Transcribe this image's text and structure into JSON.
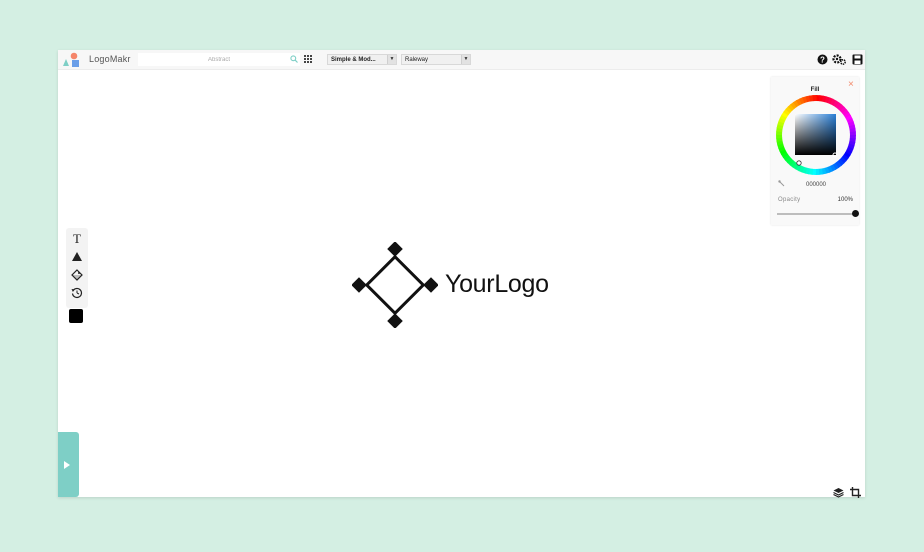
{
  "app": {
    "name": "LogoMakr"
  },
  "toolbar": {
    "search_placeholder": "Abstract",
    "style_select": "Simple & Mod...",
    "font_select": "Raleway"
  },
  "canvas": {
    "logo_text": "YourLogo"
  },
  "fill_panel": {
    "title": "Fill",
    "close_label": "×",
    "hex_value": "000000",
    "opacity_label": "Opacity",
    "opacity_value": "100%",
    "opacity_level": 1.0
  },
  "colors": {
    "accent": "#7ecfc6",
    "current_fill": "#000000",
    "close": "#f28a6b"
  },
  "icons": [
    "text-tool-icon",
    "shape-tool-icon",
    "symbol-tool-icon",
    "history-icon",
    "help-icon",
    "settings-icon",
    "save-icon",
    "search-icon",
    "grid-icon",
    "layers-icon",
    "crop-icon",
    "eyedropper-icon",
    "play-icon"
  ]
}
